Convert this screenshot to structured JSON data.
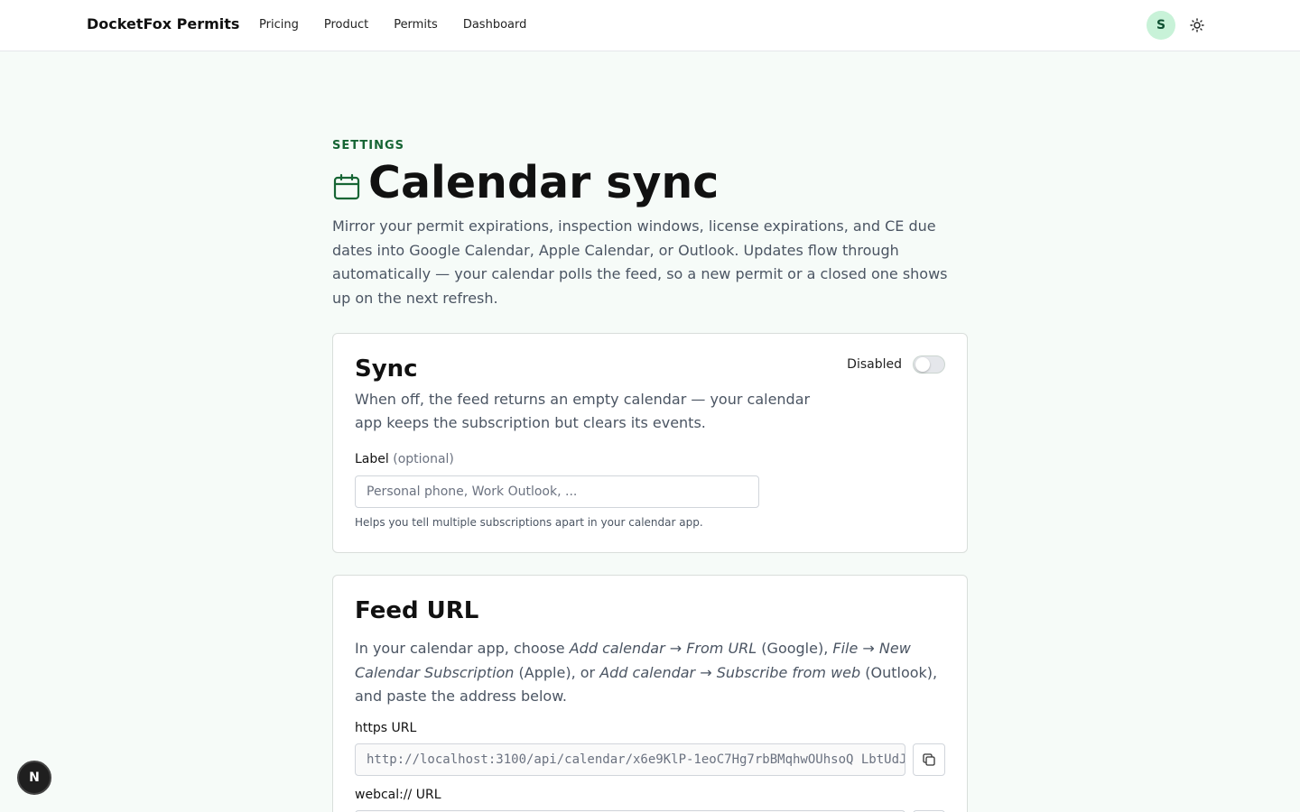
{
  "header": {
    "brand": "DocketFox Permits",
    "nav": [
      "Pricing",
      "Product",
      "Permits",
      "Dashboard"
    ],
    "avatar_initial": "S"
  },
  "page": {
    "eyebrow": "SETTINGS",
    "title": "Calendar sync",
    "intro": "Mirror your permit expirations, inspection windows, license expirations, and CE due dates into Google Calendar, Apple Calendar, or Outlook. Updates flow through automatically — your calendar polls the feed, so a new permit or a closed one shows up on the next refresh."
  },
  "sync": {
    "title": "Sync",
    "description": "When off, the feed returns an empty calendar — your calendar app keeps the subscription but clears its events.",
    "toggle_label": "Disabled",
    "label_field": "Label",
    "label_optional": "(optional)",
    "label_placeholder": "Personal phone, Work Outlook, ...",
    "helper": "Helps you tell multiple subscriptions apart in your calendar app."
  },
  "feed": {
    "title": "Feed URL",
    "desc_1": "In your calendar app, choose ",
    "desc_em_1": "Add calendar → From URL",
    "desc_2": " (Google), ",
    "desc_em_2": "File → New Calendar Subscription",
    "desc_3": " (Apple), or ",
    "desc_em_3": "Add calendar → Subscribe from web",
    "desc_4": " (Outlook), and paste the address below.",
    "https_label": "https URL",
    "https_value": "http://localhost:3100/api/calendar/x6e9KlP-1eoC7Hg7rbBMqhwOUhsoQ LbtUdJ",
    "webcal_label": "webcal:// URL",
    "webcal_value": ""
  },
  "dev_badge": "N",
  "colors": {
    "accent": "#166534",
    "avatar_bg": "#c8f2d8",
    "page_bg": "#f6fbf8"
  }
}
